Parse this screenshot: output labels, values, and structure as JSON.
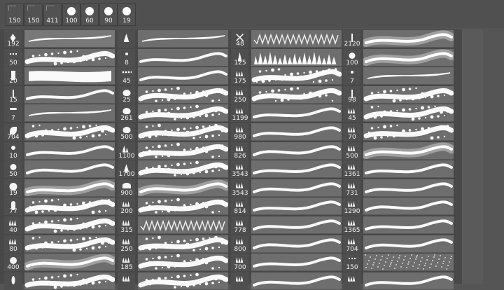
{
  "top_presets": [
    {
      "label": "150",
      "dot": 0
    },
    {
      "label": "150",
      "dot": 0
    },
    {
      "label": "411",
      "dot": 0
    },
    {
      "label": "100",
      "dot": 12
    },
    {
      "label": "60",
      "dot": 12
    },
    {
      "label": "90",
      "dot": 12
    },
    {
      "label": "19",
      "dot": 12
    }
  ],
  "columns": [
    {
      "brushes": [
        {
          "size": "192",
          "icon": "diamond",
          "style": "taper"
        },
        {
          "size": "50",
          "icon": "dots",
          "style": "spatter"
        },
        {
          "size": "20",
          "icon": "bar",
          "style": "flat"
        },
        {
          "size": "15",
          "icon": "bar-thin",
          "style": "smooth"
        },
        {
          "size": "7",
          "icon": "stroke-tip",
          "style": "taper"
        },
        {
          "size": "704",
          "icon": "leaf",
          "style": "foliage"
        },
        {
          "size": "10",
          "icon": "circle-sm",
          "style": "smooth"
        },
        {
          "size": "50",
          "icon": "circle",
          "style": "smooth"
        },
        {
          "size": "19",
          "icon": "circle-lg",
          "style": "soft"
        },
        {
          "size": "77",
          "icon": "pill",
          "style": "rough"
        },
        {
          "size": "40",
          "icon": "grass",
          "style": "spatter"
        },
        {
          "size": "80",
          "icon": "grass",
          "style": "rough"
        },
        {
          "size": "400",
          "icon": "burst",
          "style": "soft"
        },
        {
          "size": "",
          "icon": "feather",
          "style": "rough"
        }
      ]
    },
    {
      "brushes": [
        {
          "size": "",
          "icon": "tri",
          "style": "taper"
        },
        {
          "size": "8",
          "icon": "dot",
          "style": "smooth"
        },
        {
          "size": "45",
          "icon": "dots-row",
          "style": "smooth"
        },
        {
          "size": "25",
          "icon": "tree",
          "style": "foliage"
        },
        {
          "size": "261",
          "icon": "tree",
          "style": "foliage"
        },
        {
          "size": "500",
          "icon": "tree",
          "style": "foliage"
        },
        {
          "size": "1100",
          "icon": "trees",
          "style": "foliage"
        },
        {
          "size": "1700",
          "icon": "tree-tall",
          "style": "foliage"
        },
        {
          "size": "900",
          "icon": "umbrella",
          "style": "soft"
        },
        {
          "size": "200",
          "icon": "grass",
          "style": "rough"
        },
        {
          "size": "315",
          "icon": "grass",
          "style": "zigzag"
        },
        {
          "size": "250",
          "icon": "grass",
          "style": "foliage"
        },
        {
          "size": "185",
          "icon": "grass",
          "style": "foliage"
        },
        {
          "size": "",
          "icon": "grass",
          "style": "rough"
        }
      ]
    },
    {
      "brushes": [
        {
          "size": "48",
          "icon": "x",
          "style": "zigzag"
        },
        {
          "size": "125",
          "icon": "spike",
          "style": "forest"
        },
        {
          "size": "175",
          "icon": "grass",
          "style": "foliage"
        },
        {
          "size": "250",
          "icon": "grass",
          "style": "foliage"
        },
        {
          "size": "1199",
          "icon": "grass",
          "style": "smooth"
        },
        {
          "size": "980",
          "icon": "grass",
          "style": "smooth"
        },
        {
          "size": "826",
          "icon": "grass",
          "style": "smooth"
        },
        {
          "size": "3543",
          "icon": "grass",
          "style": "smooth"
        },
        {
          "size": "3543",
          "icon": "grass",
          "style": "smooth"
        },
        {
          "size": "814",
          "icon": "grass",
          "style": "smooth"
        },
        {
          "size": "778",
          "icon": "grass",
          "style": "smooth"
        },
        {
          "size": "800",
          "icon": "grass",
          "style": "smooth"
        },
        {
          "size": "700",
          "icon": "grass",
          "style": "smooth"
        },
        {
          "size": "",
          "icon": "grass",
          "style": "smooth"
        }
      ]
    },
    {
      "brushes": [
        {
          "size": "2120",
          "icon": "bar-thin",
          "style": "soft"
        },
        {
          "size": "100",
          "icon": "circle",
          "style": "soft"
        },
        {
          "size": "7",
          "icon": "dot",
          "style": "taper"
        },
        {
          "size": "98",
          "icon": "bar-thin",
          "style": "rough"
        },
        {
          "size": "45",
          "icon": "grass",
          "style": "spatter"
        },
        {
          "size": "70",
          "icon": "grass",
          "style": "rough"
        },
        {
          "size": "500",
          "icon": "grass",
          "style": "soft"
        },
        {
          "size": "1361",
          "icon": "grass",
          "style": "smooth"
        },
        {
          "size": "731",
          "icon": "grass",
          "style": "smooth"
        },
        {
          "size": "1290",
          "icon": "grass",
          "style": "smooth"
        },
        {
          "size": "1365",
          "icon": "grass",
          "style": "smooth"
        },
        {
          "size": "704",
          "icon": "grass",
          "style": "smooth"
        },
        {
          "size": "150",
          "icon": "dots",
          "style": "noise"
        },
        {
          "size": "",
          "icon": "grass",
          "style": "smooth"
        }
      ]
    }
  ]
}
